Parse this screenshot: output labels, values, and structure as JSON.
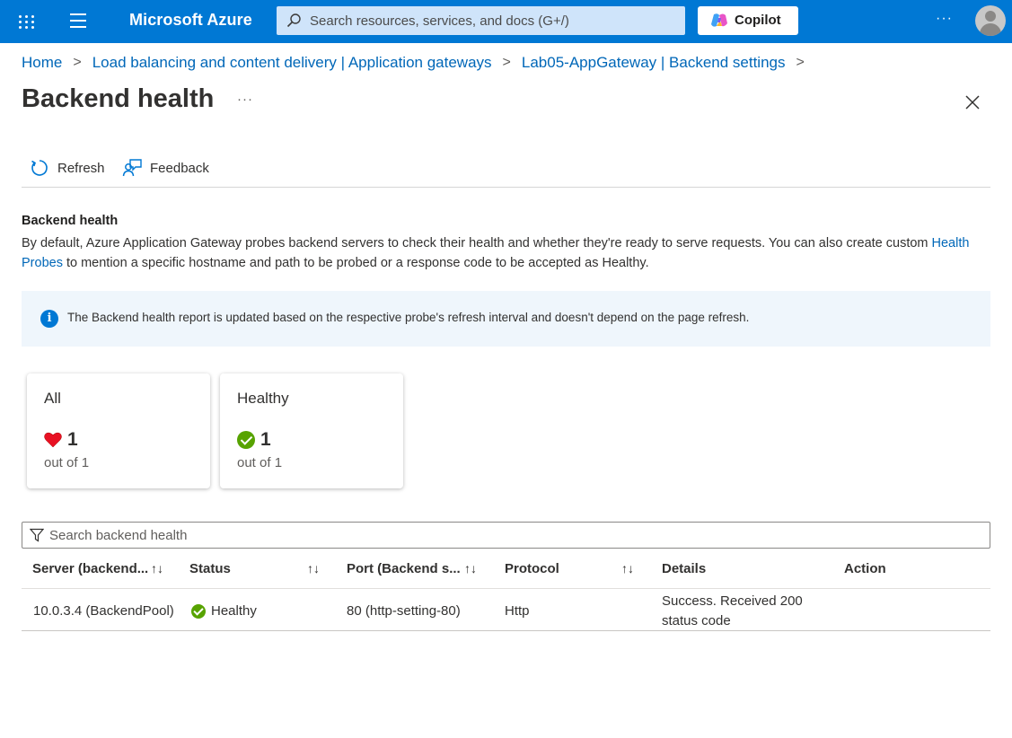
{
  "topbar": {
    "brand": "Microsoft Azure",
    "search_placeholder": "Search resources, services, and docs (G+/)",
    "copilot_label": "Copilot",
    "more": "···",
    "accent_color": "#0078d4"
  },
  "breadcrumb": {
    "items": [
      "Home",
      "Load balancing and content delivery | Application gateways",
      "Lab05-AppGateway | Backend settings"
    ],
    "separator": ">"
  },
  "page": {
    "title": "Backend health",
    "more": "···"
  },
  "commands": {
    "refresh": "Refresh",
    "feedback": "Feedback"
  },
  "section": {
    "title": "Backend health",
    "desc_before": "By default, Azure Application Gateway probes backend servers to check their health and whether they're ready to serve requests. You can also create custom ",
    "desc_link": "Health Probes",
    "desc_after": " to mention a specific hostname and path to be probed or a response code to be accepted as Healthy."
  },
  "info": {
    "text": "The Backend health report is updated based on the respective probe's refresh interval and doesn't depend on the page refresh."
  },
  "cards": [
    {
      "title": "All",
      "count": "1",
      "sub": "out of 1",
      "icon": "heart-icon"
    },
    {
      "title": "Healthy",
      "count": "1",
      "sub": "out of 1",
      "icon": "check-circle-icon"
    }
  ],
  "filter": {
    "placeholder": "Search backend health"
  },
  "table": {
    "columns": [
      "Server (backend...",
      "Status",
      "Port (Backend s...",
      "Protocol",
      "Details",
      "Action"
    ],
    "sort_glyph": "↑↓",
    "rows": [
      {
        "server": "10.0.3.4 (BackendPool)",
        "status": "Healthy",
        "port": "80 (http-setting-80)",
        "protocol": "Http",
        "details_line1": "Success. Received 200",
        "details_line2": "status code",
        "action": ""
      }
    ]
  }
}
